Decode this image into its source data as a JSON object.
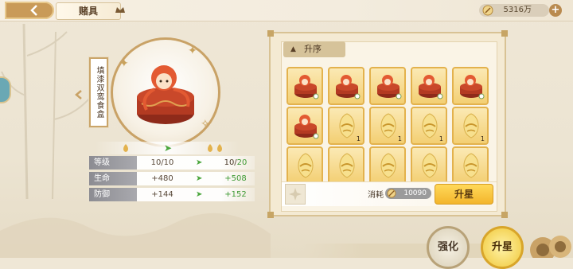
{
  "header": {
    "title": "赌具",
    "currency": "5316万",
    "plus_label": "+"
  },
  "item": {
    "name": "填漆双鸾食盒"
  },
  "stats": [
    {
      "label": "等级",
      "from": "10/10",
      "to_a": "10/",
      "to_b": "20"
    },
    {
      "label": "生命",
      "from": "+480",
      "to_a": "",
      "to_b": "+508"
    },
    {
      "label": "防御",
      "from": "+144",
      "to_a": "",
      "to_b": "+152"
    }
  ],
  "right_panel": {
    "sort_label": "升序",
    "slots": [
      {
        "kind": "box",
        "count": ""
      },
      {
        "kind": "box",
        "count": ""
      },
      {
        "kind": "box",
        "count": ""
      },
      {
        "kind": "box",
        "count": ""
      },
      {
        "kind": "box",
        "count": ""
      },
      {
        "kind": "box",
        "count": ""
      },
      {
        "kind": "egg",
        "count": "1"
      },
      {
        "kind": "egg",
        "count": "1"
      },
      {
        "kind": "egg",
        "count": "1"
      },
      {
        "kind": "egg",
        "count": "1"
      },
      {
        "kind": "egg",
        "count": ""
      },
      {
        "kind": "egg",
        "count": ""
      },
      {
        "kind": "egg",
        "count": ""
      },
      {
        "kind": "egg",
        "count": ""
      },
      {
        "kind": "egg",
        "count": ""
      }
    ],
    "cost_label": "消耗",
    "cost_value": "10090",
    "star_button": "升星"
  },
  "bottom_buttons": {
    "enhance": "强化",
    "upgrade": "升星"
  },
  "colors": {
    "accent_gold": "#f3b52b",
    "frame_gold": "#c9a266",
    "up_green": "#3f9a34"
  }
}
